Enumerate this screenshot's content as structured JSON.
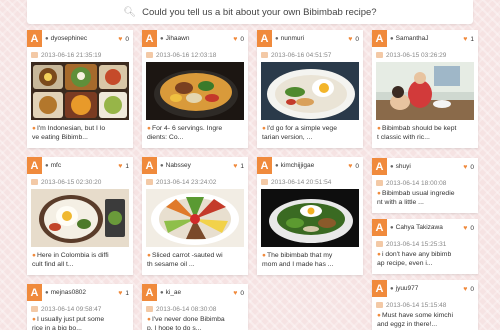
{
  "search": {
    "icon": "search-icon",
    "question": "Could you tell us a bit about your own Bibimbab recipe?"
  },
  "avatar_letter": "A",
  "accent_color": "#f08a3c",
  "cards": [
    {
      "user": "dyosephinec",
      "likes": "0",
      "date": "2013-06-16 21:35:19",
      "caption": "I'm Indonesian, but I lo\nve eating Bibimb..."
    },
    {
      "user": "Jihaawn",
      "likes": "0",
      "date": "2013-06-16 12:03:18",
      "caption": "For 4- 6 servings. Ingre\ndients: Co..."
    },
    {
      "user": "nunmuri",
      "likes": "0",
      "date": "2013-06-16 04:51:57",
      "caption": "I'd go for a simple vege\ntarian version, ..."
    },
    {
      "user": "SamanthaJ",
      "likes": "1",
      "date": "2013-06-15 03:26:29",
      "caption": "Bibimbab should be kept\nt classic with ric..."
    },
    {
      "user": "mfc",
      "likes": "1",
      "date": "2013-06-15 02:30:20",
      "caption": "Here in Colombia is diffi\ncult find all t..."
    },
    {
      "user": "Nabssey",
      "likes": "1",
      "date": "2013-06-14 23:24:02",
      "caption": "Sliced carrot -sauted wi\nth sesame oil ..."
    },
    {
      "user": "kimchijjigae",
      "likes": "0",
      "date": "2013-06-14 20:51:54",
      "caption": "The bibimbab that my\nmom and I made has ..."
    },
    {
      "user": "shuyi",
      "likes": "0",
      "date": "2013-06-14 18:00:08",
      "caption": "Bibimbab usual ingredie\nnt with a little ..."
    },
    {
      "user": "Cahya Takizawa",
      "likes": "0",
      "date": "2013-06-14 15:25:31",
      "caption": "i don't have any bibimb\nap recipe, even i..."
    },
    {
      "user": "jyuu977",
      "likes": "0",
      "date": "2013-06-14 15:15:48",
      "caption": "Must have some kimchi\nand eggz in there!..."
    },
    {
      "user": "mejnas0802",
      "likes": "1",
      "date": "2013-06-14 09:58:47",
      "caption": "I usually just put some\nrice in a big bo..."
    },
    {
      "user": "ki_ae",
      "likes": "0",
      "date": "2013-06-14 08:30:08",
      "caption": "I've never done Bibimba\np. I hope to do s..."
    }
  ]
}
